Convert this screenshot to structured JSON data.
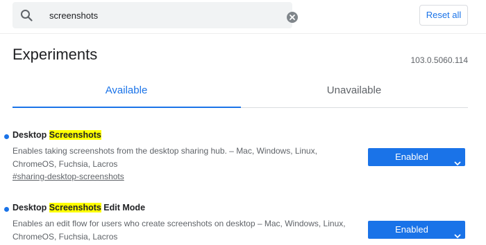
{
  "search": {
    "value": "screenshots",
    "placeholder": "Search flags"
  },
  "toolbar": {
    "reset_label": "Reset all"
  },
  "header": {
    "title": "Experiments",
    "version": "103.0.5060.114"
  },
  "tabs": [
    {
      "label": "Available",
      "active": true
    },
    {
      "label": "Unavailable",
      "active": false
    }
  ],
  "experiments": [
    {
      "title_prefix": "Desktop ",
      "title_highlight": "Screenshots",
      "title_suffix": "",
      "description": "Enables taking screenshots from the desktop sharing hub. – Mac, Windows, Linux, ChromeOS, Fuchsia, Lacros",
      "link": "#sharing-desktop-screenshots",
      "state": "Enabled"
    },
    {
      "title_prefix": "Desktop ",
      "title_highlight": "Screenshots",
      "title_suffix": " Edit Mode",
      "description": "Enables an edit flow for users who create screenshots on desktop – Mac, Windows, Linux, ChromeOS, Fuchsia, Lacros",
      "state": "Enabled"
    }
  ],
  "colors": {
    "accent": "#1a73e8",
    "highlight": "#ffff00",
    "search_bg": "#f1f3f4"
  },
  "icons": {
    "search": "search-icon",
    "clear": "close-circle-icon",
    "dropdown": "chevron-down-icon",
    "modified": "dot-indicator-icon"
  }
}
